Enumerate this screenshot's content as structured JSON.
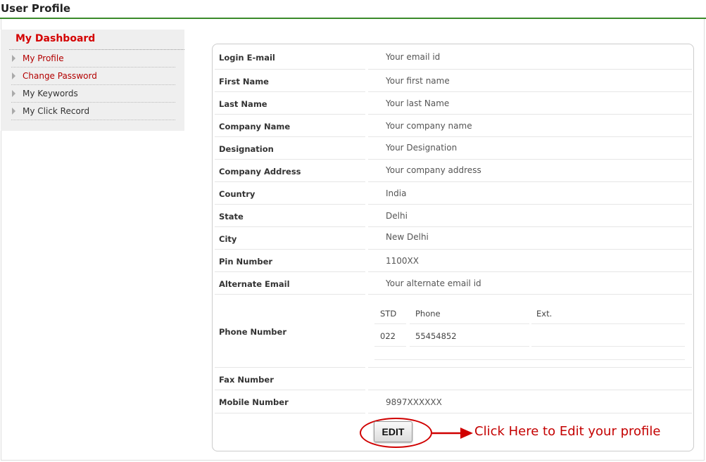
{
  "header": {
    "title": "User Profile"
  },
  "sidebar": {
    "title": "My Dashboard",
    "items": [
      {
        "label": "My Profile"
      },
      {
        "label": "Change Password"
      },
      {
        "label": "My Keywords"
      },
      {
        "label": "My Click Record"
      }
    ]
  },
  "profile": {
    "fields": [
      {
        "label": "Login E-mail",
        "value": "Your email id"
      },
      {
        "label": "First Name",
        "value": "Your first name"
      },
      {
        "label": "Last Name",
        "value": "Your last Name"
      },
      {
        "label": "Company Name",
        "value": "Your company name"
      },
      {
        "label": "Designation",
        "value": "Your Designation"
      },
      {
        "label": "Company Address",
        "value": "Your company address"
      },
      {
        "label": "Country",
        "value": "India"
      },
      {
        "label": "State",
        "value": "Delhi"
      },
      {
        "label": "City",
        "value": "New Delhi"
      },
      {
        "label": "Pin Number",
        "value": "1100XX"
      },
      {
        "label": "Alternate Email",
        "value": "Your alternate email id"
      }
    ],
    "phone": {
      "label": "Phone Number",
      "headers": {
        "std": "STD",
        "phone": "Phone",
        "ext": "Ext."
      },
      "values": {
        "std": "022",
        "phone": "55454852",
        "ext": ""
      }
    },
    "fax": {
      "label": "Fax Number",
      "value": ""
    },
    "mobile": {
      "label": "Mobile Number",
      "value": "9897XXXXXX"
    }
  },
  "actions": {
    "edit_label": "EDIT"
  },
  "annotation": {
    "text": "Click Here to Edit your profile"
  },
  "colors": {
    "accent_green": "#3a8a2a",
    "dashboard_red": "#d40000",
    "annotation_red": "#c40000"
  }
}
